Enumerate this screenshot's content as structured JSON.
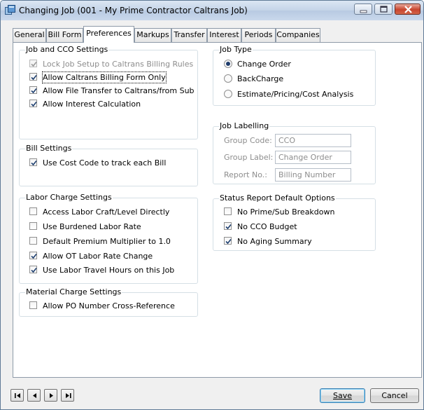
{
  "window": {
    "title": "Changing Job  (001 - My Prime Contractor Caltrans Job)"
  },
  "tabs": [
    {
      "label": "General",
      "active": false
    },
    {
      "label": "Bill Form",
      "active": false
    },
    {
      "label": "Preferences",
      "active": true
    },
    {
      "label": "Markups",
      "active": false
    },
    {
      "label": "Transfer",
      "active": false
    },
    {
      "label": "Interest",
      "active": false
    },
    {
      "label": "Periods",
      "active": false
    },
    {
      "label": "Companies",
      "active": false
    }
  ],
  "job_cco": {
    "legend": "Job and CCO Settings",
    "items": [
      {
        "label": "Lock Job Setup to Caltrans Billing Rules",
        "checked": true,
        "disabled": true
      },
      {
        "label": "Allow Caltrans Billing Form Only",
        "checked": true,
        "focused": true
      },
      {
        "label": "Allow File Transfer to Caltrans/from Sub",
        "checked": true
      },
      {
        "label": "Allow Interest Calculation",
        "checked": true
      }
    ]
  },
  "bill_settings": {
    "legend": "Bill Settings",
    "items": [
      {
        "label": "Use Cost Code to track each Bill",
        "checked": true
      }
    ]
  },
  "labor": {
    "legend": "Labor Charge Settings",
    "items": [
      {
        "label": "Access Labor Craft/Level Directly",
        "checked": false
      },
      {
        "label": "Use Burdened Labor Rate",
        "checked": false
      },
      {
        "label": "Default Premium Multiplier to 1.0",
        "checked": false
      },
      {
        "label": "Allow OT Labor Rate Change",
        "checked": true
      },
      {
        "label": "Use Labor Travel Hours on this Job",
        "checked": true
      }
    ]
  },
  "material": {
    "legend": "Material Charge Settings",
    "items": [
      {
        "label": "Allow PO Number Cross-Reference",
        "checked": false
      }
    ]
  },
  "job_type": {
    "legend": "Job Type",
    "options": [
      {
        "label": "Change Order",
        "selected": true
      },
      {
        "label": "BackCharge",
        "selected": false
      },
      {
        "label": "Estimate/Pricing/Cost Analysis",
        "selected": false
      }
    ]
  },
  "job_labelling": {
    "legend": "Job Labelling",
    "group_code_label": "Group Code:",
    "group_code_value": "CCO",
    "group_label_label": "Group Label:",
    "group_label_value": "Change Order",
    "report_no_label": "Report No.:",
    "report_no_value": "Billing Number"
  },
  "status_report": {
    "legend": "Status Report Default Options",
    "items": [
      {
        "label": "No Prime/Sub Breakdown",
        "checked": false
      },
      {
        "label": "No CCO Budget",
        "checked": true
      },
      {
        "label": "No Aging Summary",
        "checked": true
      }
    ]
  },
  "footer": {
    "save_label": "Save",
    "cancel_label": "Cancel"
  },
  "colors": {
    "check": "#1e3f6f",
    "check_disabled": "#9a9a9a"
  }
}
